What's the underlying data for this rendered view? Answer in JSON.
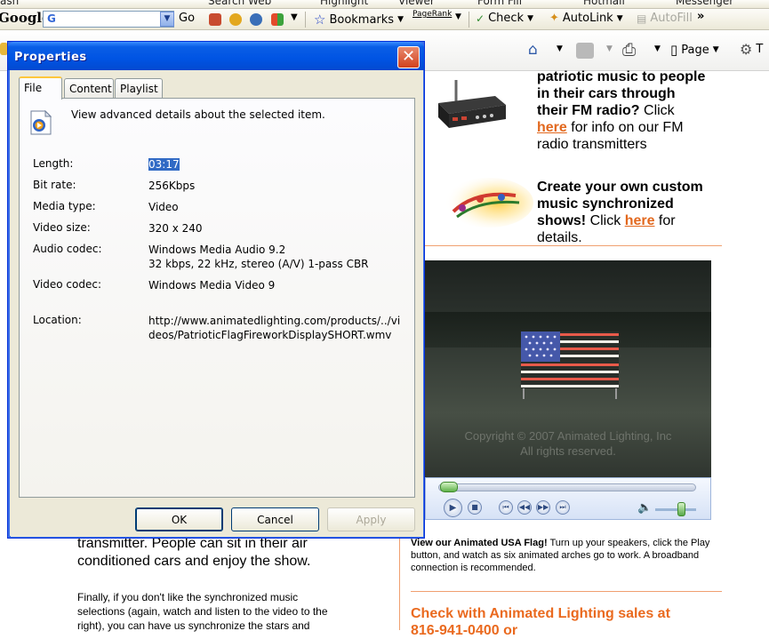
{
  "toolbar_top": {
    "cut_items": [
      "ash",
      "Search Web",
      "Highlight",
      "Viewer",
      "Form Fill",
      "Hotmail",
      "Messenger"
    ]
  },
  "toolbar_google": {
    "logo": "Google",
    "search_value": "G",
    "go_label": "Go",
    "bookmarks_label": "Bookmarks",
    "pagerank_label": "PageRank",
    "check_label": "Check",
    "autolink_label": "AutoLink",
    "autofill_label": "AutoFill",
    "more_label": "»"
  },
  "toolbar_ie": {
    "page_label": "Page",
    "tools_cut_label": "T"
  },
  "dialog": {
    "title": "Properties",
    "close_label": "✕",
    "tabs": [
      {
        "label": "File",
        "active": true
      },
      {
        "label": "Content",
        "active": false
      },
      {
        "label": "Playlist",
        "active": false
      }
    ],
    "description": "View advanced details about the selected item.",
    "properties": [
      {
        "label": "Length:",
        "value": "03:17"
      },
      {
        "label": "Bit rate:",
        "value": "256Kbps"
      },
      {
        "label": "Media type:",
        "value": "Video"
      },
      {
        "label": "Video size:",
        "value": "320 x 240"
      },
      {
        "label": "Audio codec:",
        "value": "Windows Media Audio 9.2\n32 kbps, 22 kHz, stereo (A/V) 1-pass CBR"
      },
      {
        "label": "Video codec:",
        "value": "Windows Media Video 9"
      },
      {
        "label": "Location:",
        "value": "http://www.animatedlighting.com/products/../vi\ndeos/PatrioticFlagFireworkDisplaySHORT.wmv"
      }
    ],
    "buttons": {
      "ok": "OK",
      "cancel": "Cancel",
      "apply": "Apply"
    }
  },
  "page": {
    "fm_block": {
      "line1": "patriotic music to people",
      "line2": "in their cars through",
      "line3_bold": "their FM radio?",
      "line3_rest": " Click",
      "link": "here",
      "line4_rest": " for info on our FM",
      "line5": "radio transmitters"
    },
    "custom_block": {
      "line1": "Create your own custom",
      "line2": "music synchronized",
      "line3_bold": "shows!",
      "line3_rest": " Click ",
      "link": "here",
      "line3_end": " for",
      "line4": "details."
    },
    "video": {
      "watermark_line1": "Copyright © 2007 Animated Lighting, Inc",
      "watermark_line2": "All rights reserved."
    },
    "caption": {
      "bold": "View our Animated USA Flag!",
      "rest": " Turn up your speakers, click the Play button, and watch as six animated arches go to work.  A broadband connection is recommended."
    },
    "sales_heading": "Check with Animated Lighting sales at",
    "sales_phone_cut": "816-941-0400 or",
    "left_text": {
      "line1": "transmitter.  People can sit in their air",
      "line2": "conditioned cars and enjoy the show.",
      "p2_line1": "Finally, if you don't like the synchronized music",
      "p2_line2": "selections (again, watch and listen to the video to the",
      "p2_line3": "right), you can have us synchronize the stars and"
    }
  },
  "colors": {
    "link_orange": "#e2681e",
    "xp_title_blue": "#0054e3",
    "dialog_face": "#ece9d8"
  }
}
